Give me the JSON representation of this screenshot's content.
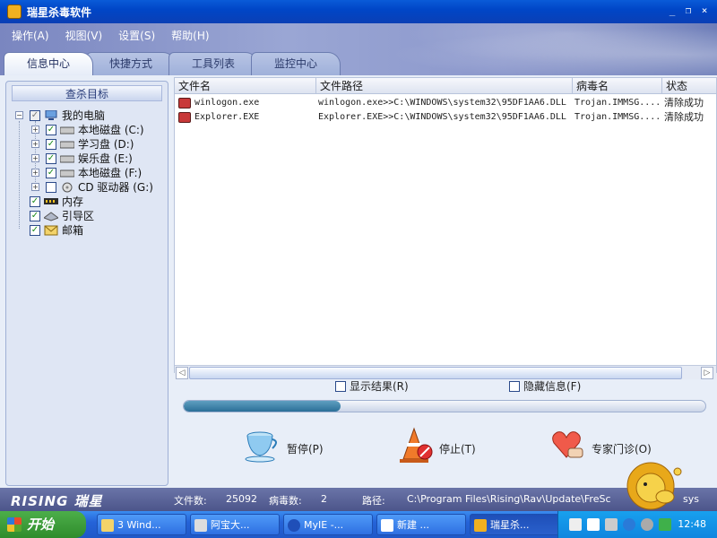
{
  "window": {
    "title": "瑞星杀毒软件"
  },
  "menu": [
    "操作(A)",
    "视图(V)",
    "设置(S)",
    "帮助(H)"
  ],
  "tabs": [
    "信息中心",
    "快捷方式",
    "工具列表",
    "监控中心"
  ],
  "left_panel": {
    "title": "查杀目标",
    "tree": [
      {
        "label": "我的电脑",
        "checked": true
      },
      {
        "label": "本地磁盘 (C:)",
        "checked": true
      },
      {
        "label": "学习盘 (D:)",
        "checked": true
      },
      {
        "label": "娱乐盘 (E:)",
        "checked": true
      },
      {
        "label": "本地磁盘 (F:)",
        "checked": true
      },
      {
        "label": "CD 驱动器 (G:)",
        "checked": false
      },
      {
        "label": "内存",
        "checked": true
      },
      {
        "label": "引导区",
        "checked": true
      },
      {
        "label": "邮箱",
        "checked": true
      }
    ]
  },
  "grid": {
    "headers": [
      "文件名",
      "文件路径",
      "病毒名",
      "状态"
    ],
    "rows": [
      {
        "file": "winlogon.exe",
        "path": "winlogon.exe>>C:\\WINDOWS\\system32\\95DF1AA6.DLL",
        "virus": "Trojan.IMMSG....",
        "status": "清除成功"
      },
      {
        "file": "Explorer.EXE",
        "path": "Explorer.EXE>>C:\\WINDOWS\\system32\\95DF1AA6.DLL",
        "virus": "Trojan.IMMSG....",
        "status": "清除成功"
      }
    ]
  },
  "options": {
    "show_results": "显示结果(R)",
    "hide_info": "隐藏信息(F)"
  },
  "progress": {
    "fraction": 0.3
  },
  "actions": {
    "pause": "暂停(P)",
    "stop": "停止(T)",
    "expert": "专家门诊(O)"
  },
  "statusbar": {
    "brand": "RISING 瑞星",
    "files_label": "文件数:",
    "files_value": "25092",
    "virus_label": "病毒数:",
    "virus_value": "2",
    "path_label": "路径:",
    "path_value": "C:\\Program Files\\Rising\\Rav\\Update\\FreSc",
    "tail": "sys"
  },
  "taskbar": {
    "start": "开始",
    "tasks": [
      "3 Wind...",
      "阿宝大...",
      "MyIE -...",
      "新建 ...",
      "瑞星杀..."
    ],
    "clock": "12:48"
  },
  "colors": {
    "titlebar": "#0046c7",
    "header": "#8c98cc",
    "taskbar": "#2563d8",
    "start": "#2f8c2c"
  }
}
